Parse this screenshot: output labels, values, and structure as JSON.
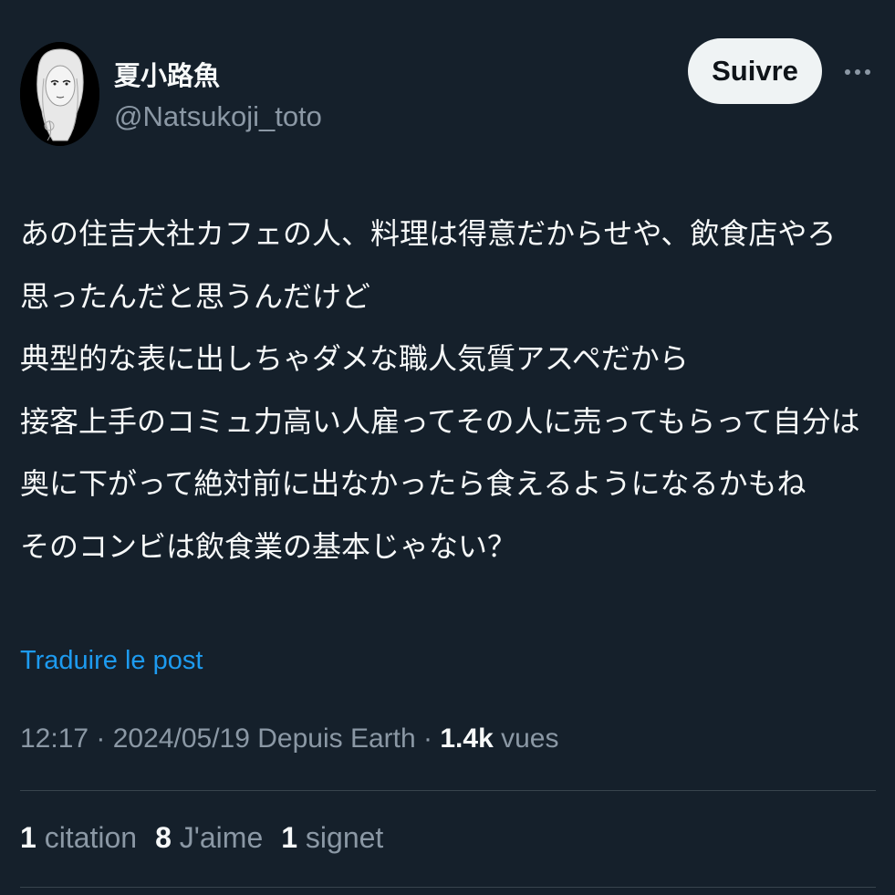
{
  "author": {
    "display_name": "夏小路魚",
    "handle": "@Natsukoji_toto",
    "avatar": "avatar-sketch-portrait"
  },
  "actions": {
    "follow_label": "Suivre",
    "more_icon": "more-horizontal-icon"
  },
  "tweet": {
    "lines": [
      "あの住吉大社カフェの人、料理は得意だからせや、飲食店やろ",
      "思ったんだと思うんだけど",
      "典型的な表に出しちゃダメな職人気質アスペだから",
      "接客上手のコミュ力高い人雇ってその人に売ってもらって自分は",
      "奥に下がって絶対前に出なかったら食えるようになるかもね",
      "そのコンビは飲食業の基本じゃない？"
    ],
    "translate_label": "Traduire le post"
  },
  "meta": {
    "time": "12:17",
    "separator": " · ",
    "date": "2024/05/19",
    "source": "Depuis Earth",
    "views_count": "1.4k",
    "views_label": "vues"
  },
  "stats": {
    "quotes_count": "1",
    "quotes_label": "citation",
    "likes_count": "8",
    "likes_label": "J'aime",
    "bookmarks_count": "1",
    "bookmarks_label": "signet"
  },
  "colors": {
    "background": "#15202b",
    "text_primary": "#f7f9f9",
    "text_secondary": "#8b98a5",
    "link": "#1d9bf0",
    "button_bg": "#eff3f4",
    "divider": "#38444d"
  }
}
